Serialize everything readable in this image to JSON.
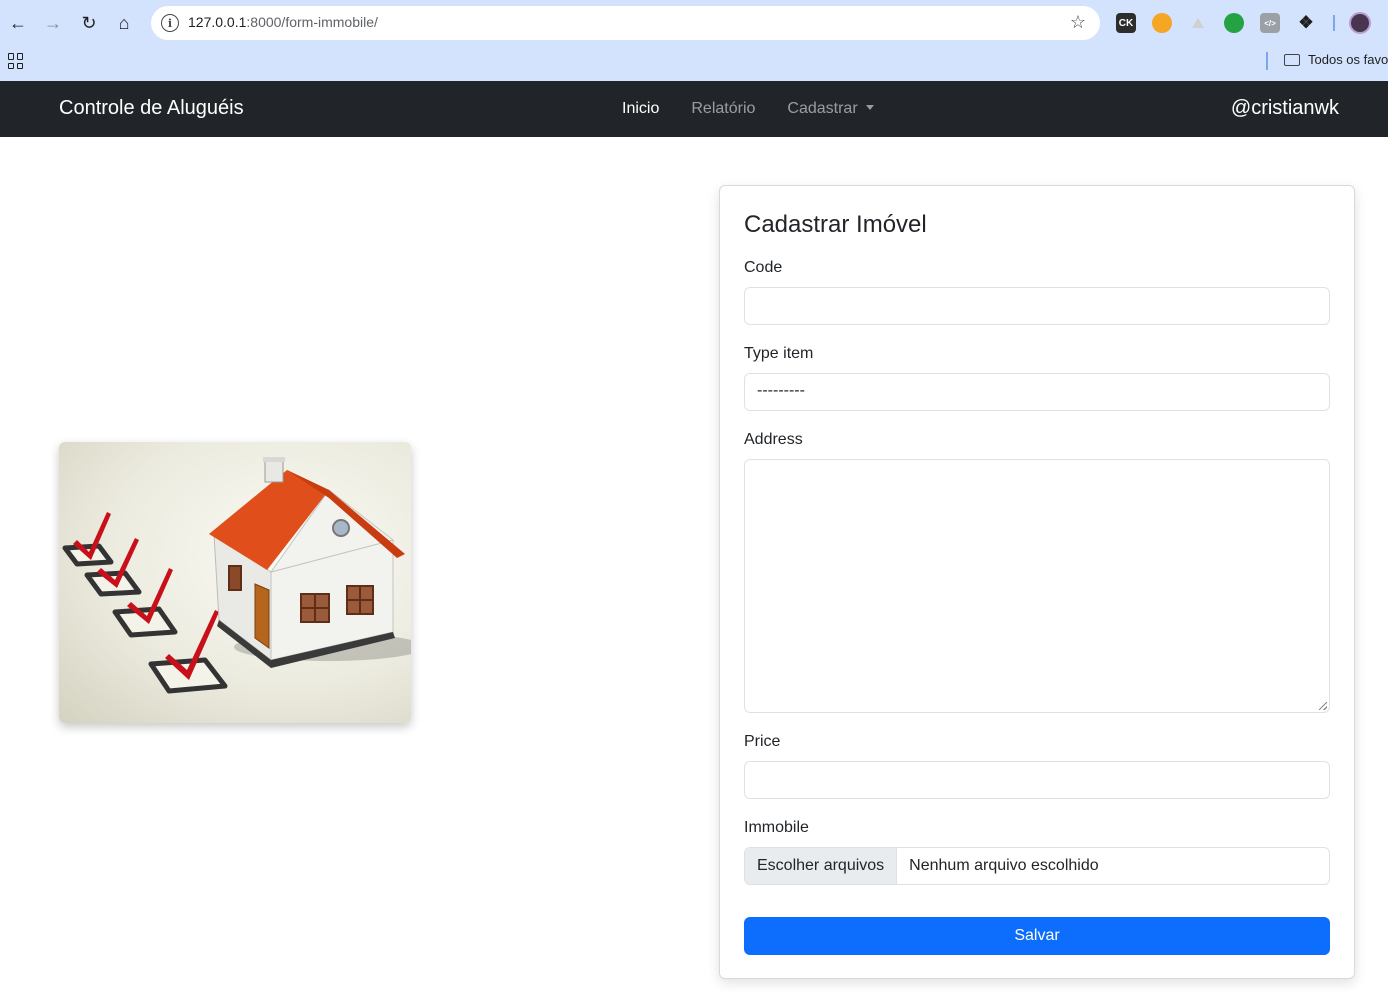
{
  "browser": {
    "url_host": "127.0.0.1",
    "url_path": ":8000/form-immobile/",
    "bookmark_folder": "Todos os favoritos",
    "extensions": [
      {
        "name": "ck-extension-icon",
        "label": "CK",
        "color": "#2d2d2d"
      },
      {
        "name": "orange-extension-icon",
        "label": "",
        "color": "#f5a623"
      },
      {
        "name": "triangle-extension-icon",
        "label": "",
        "color": "#c8c8c8"
      },
      {
        "name": "whatsapp-extension-icon",
        "label": "",
        "color": "#25a244"
      },
      {
        "name": "code-extension-icon",
        "label": "</>",
        "color": "#9aa0a6"
      }
    ]
  },
  "navbar": {
    "brand": "Controle de Aluguéis",
    "links": [
      "Inicio",
      "Relatório",
      "Cadastrar"
    ],
    "user": "@cristianwk"
  },
  "form": {
    "title": "Cadastrar Imóvel",
    "code_label": "Code",
    "code_value": "",
    "type_label": "Type item",
    "type_value": "---------",
    "address_label": "Address",
    "address_value": "",
    "price_label": "Price",
    "price_value": "",
    "immobile_label": "Immobile",
    "file_button": "Escolher arquivos",
    "file_status": "Nenhum arquivo escolhido",
    "submit": "Salvar"
  },
  "colors": {
    "navbar_bg": "#212529",
    "primary": "#0d6efd",
    "chrome_bg": "#d3e3fd"
  }
}
